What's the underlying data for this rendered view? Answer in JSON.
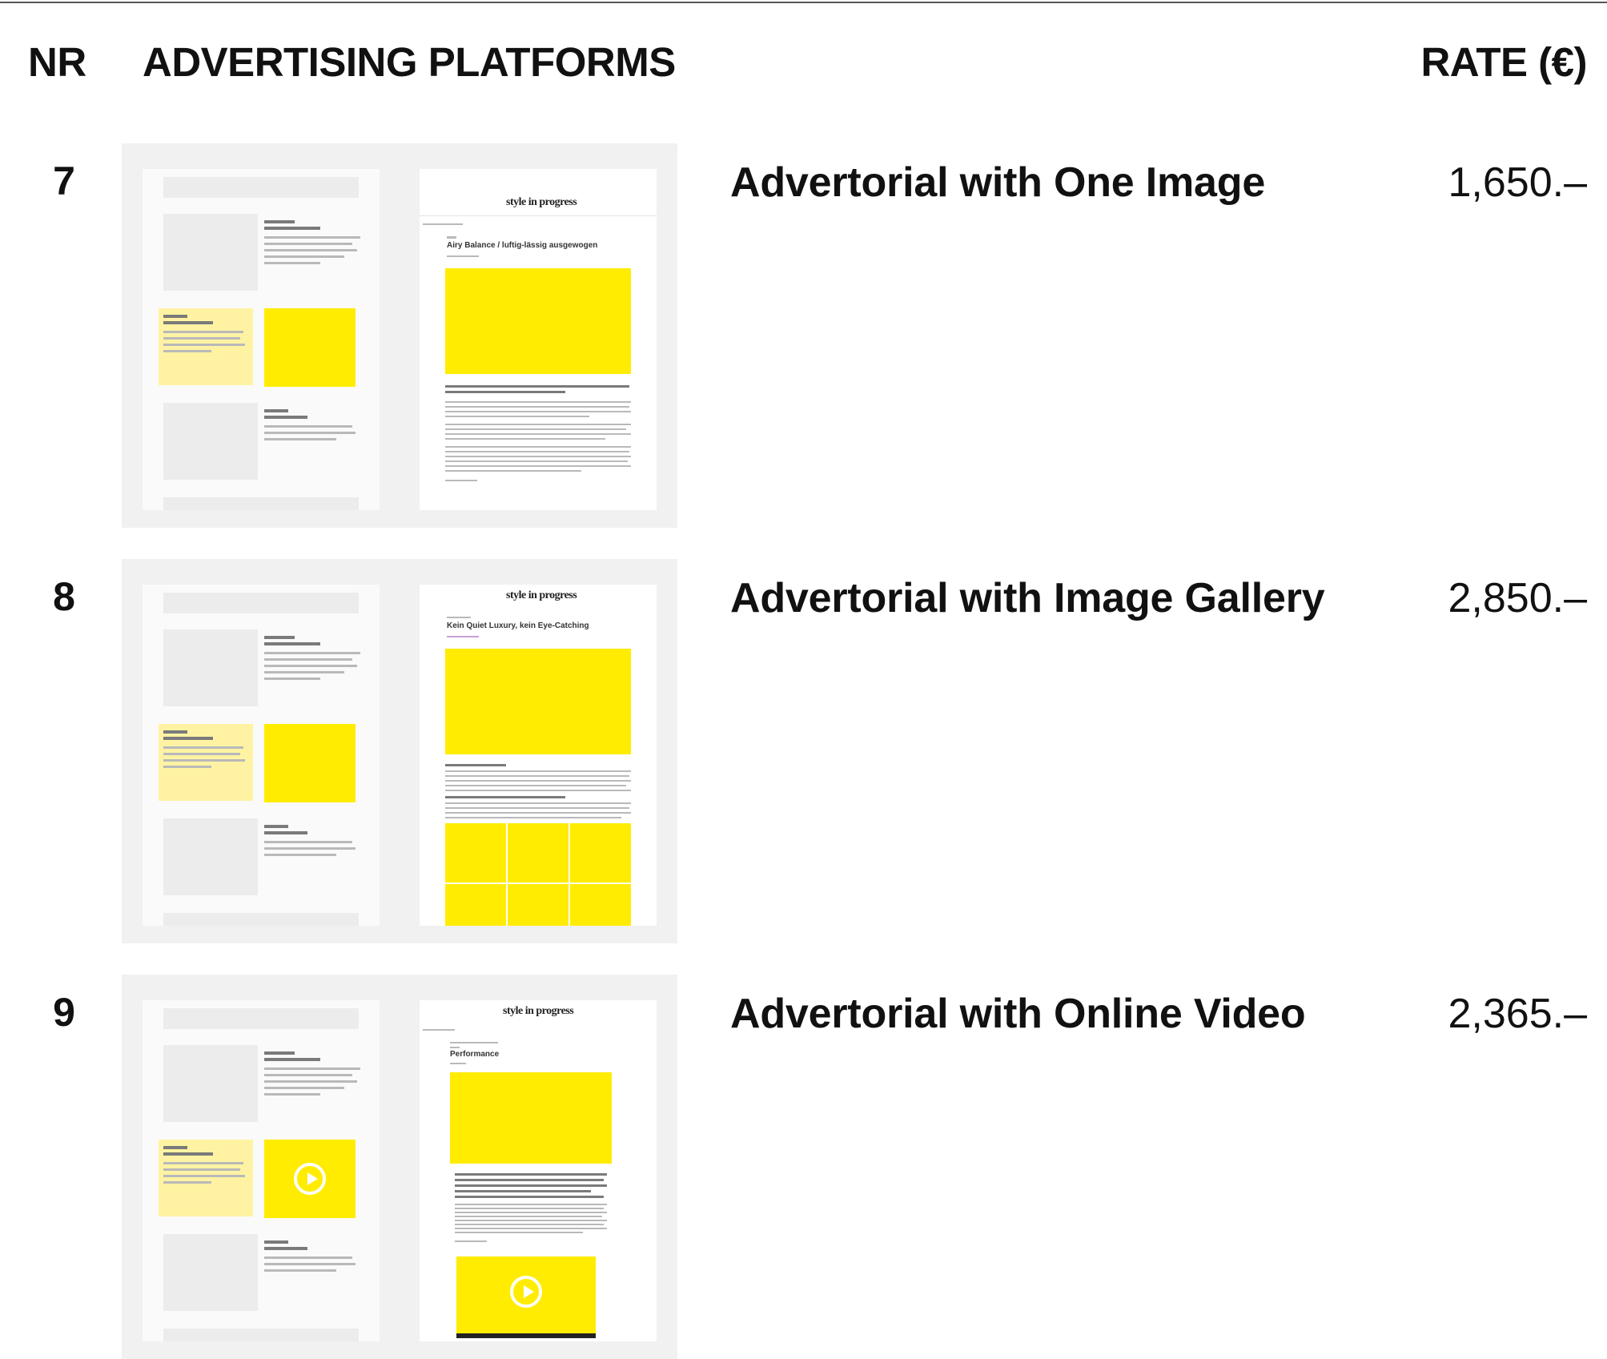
{
  "header": {
    "nr": "NR",
    "platforms": "ADVERTISING PLATFORMS",
    "rate": "RATE (€)"
  },
  "rows": [
    {
      "nr": "7",
      "title": "Advertorial with One Image",
      "rate": "1,650.–",
      "thumbnail": {
        "logo": "style in progress",
        "article_title": "Airy Balance / luftig-lässig ausgewogen"
      }
    },
    {
      "nr": "8",
      "title": "Advertorial with Image Gallery",
      "rate": "2,850.–",
      "thumbnail": {
        "logo": "style in progress",
        "article_title": "Kein Quiet Luxury, kein Eye-Catching"
      }
    },
    {
      "nr": "9",
      "title": "Advertorial with Online Video",
      "rate": "2,365.–",
      "thumbnail": {
        "logo": "style in progress",
        "article_title": "Performance"
      }
    }
  ],
  "colors": {
    "accent_yellow": "#ffec00",
    "pale_yellow": "#fff3a3",
    "thumb_bg": "#f1f1f1"
  },
  "icons": [
    "play-icon"
  ]
}
